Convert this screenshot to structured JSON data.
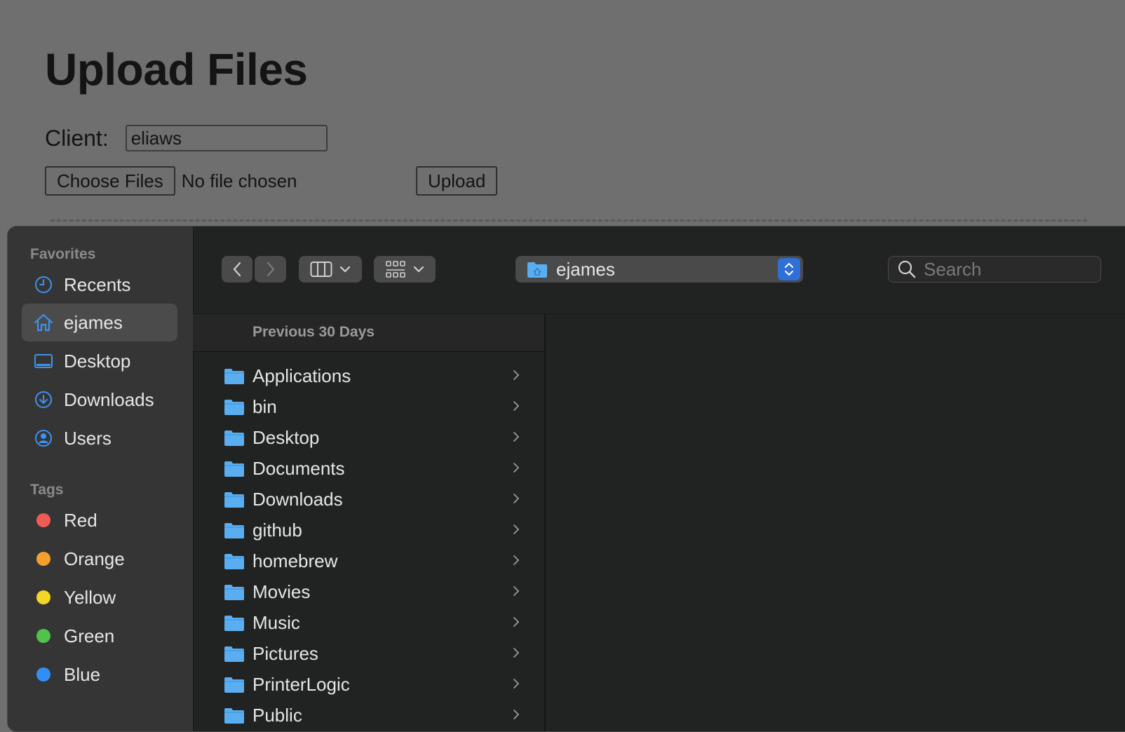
{
  "webpage": {
    "title": "Upload Files",
    "client_label": "Client:",
    "client_value": "eliaws",
    "choose_files_label": "Choose Files",
    "no_file_text": "No file chosen",
    "upload_label": "Upload"
  },
  "dialog": {
    "favorites_title": "Favorites",
    "favorites": [
      {
        "label": "Recents",
        "icon": "clock-icon"
      },
      {
        "label": "ejames",
        "icon": "home-icon",
        "selected": true
      },
      {
        "label": "Desktop",
        "icon": "desktop-icon"
      },
      {
        "label": "Downloads",
        "icon": "download-icon"
      },
      {
        "label": "Users",
        "icon": "user-icon"
      }
    ],
    "tags_title": "Tags",
    "tags": [
      {
        "label": "Red",
        "color": "#f05c55"
      },
      {
        "label": "Orange",
        "color": "#f5a02d"
      },
      {
        "label": "Yellow",
        "color": "#f4d627"
      },
      {
        "label": "Green",
        "color": "#4fc34a"
      },
      {
        "label": "Blue",
        "color": "#2f8ff5"
      }
    ],
    "location": "ejames",
    "search_placeholder": "Search",
    "column_header": "Previous 30 Days",
    "items": [
      {
        "label": "Applications"
      },
      {
        "label": "bin"
      },
      {
        "label": "Desktop"
      },
      {
        "label": "Documents"
      },
      {
        "label": "Downloads"
      },
      {
        "label": "github"
      },
      {
        "label": "homebrew"
      },
      {
        "label": "Movies"
      },
      {
        "label": "Music"
      },
      {
        "label": "Pictures"
      },
      {
        "label": "PrinterLogic"
      },
      {
        "label": "Public"
      }
    ],
    "accent_color": "#2f6fd6",
    "folder_color": "#5aaef0"
  }
}
